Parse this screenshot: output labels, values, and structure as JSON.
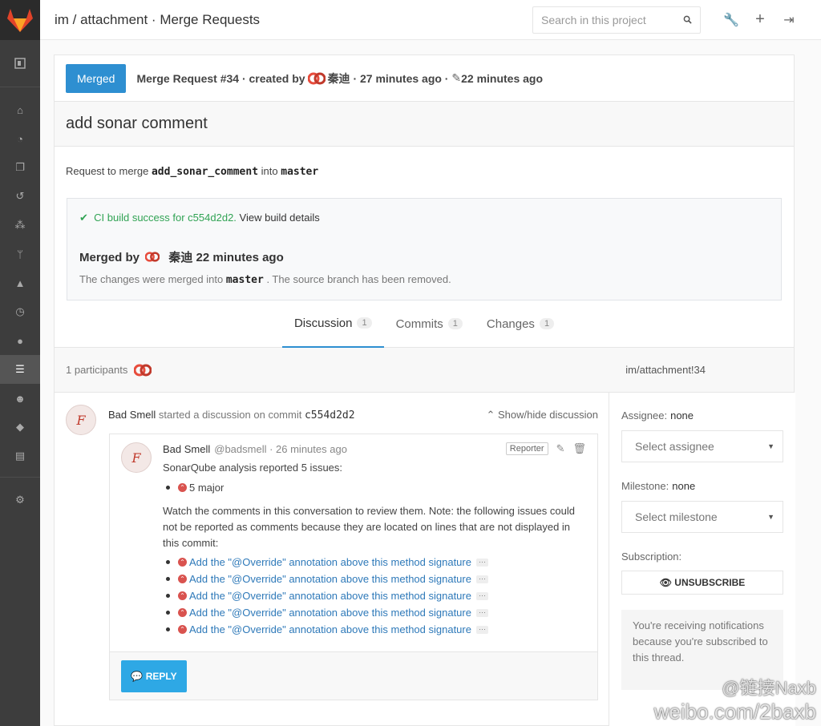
{
  "header": {
    "title": "im / attachment · Merge Requests",
    "search_placeholder": "Search in this project"
  },
  "sidebar": {
    "icons": [
      "collapse-icon",
      "home-icon",
      "dashboard-icon",
      "files-icon",
      "history-icon",
      "network-icon",
      "branch-icon",
      "graph-icon",
      "milestone-icon",
      "issues-icon",
      "merge-requests-icon",
      "members-icon",
      "labels-icon",
      "wiki-icon",
      "settings-icon"
    ]
  },
  "mr": {
    "status": "Merged",
    "meta_prefix": "Merge Request #34 · created by",
    "author": "秦迪",
    "created": "· 27 minutes ago ·",
    "edited": "22 minutes ago",
    "title": "add sonar comment",
    "request_prefix": "Request to merge",
    "source_branch": "add_sonar_comment",
    "into": "into",
    "target_branch": "master"
  },
  "ci": {
    "status_text": "CI build success for c554d2d2.",
    "details_link": "View build details",
    "merged_by_label": "Merged by",
    "merged_by_name": "秦迪",
    "merged_time": "22 minutes ago",
    "desc_prefix": "The changes were merged into",
    "desc_branch": "master",
    "desc_suffix": ". The source branch has been removed."
  },
  "tabs": [
    {
      "label": "Discussion",
      "count": "1"
    },
    {
      "label": "Commits",
      "count": "1"
    },
    {
      "label": "Changes",
      "count": "1"
    }
  ],
  "participants": {
    "label": "1 participants",
    "ref": "im/attachment!34"
  },
  "discussion": {
    "author": "Bad Smell",
    "action": "started a discussion on commit",
    "commit": "c554d2d2",
    "toggle": "Show/hide discussion",
    "note": {
      "author": "Bad Smell",
      "handle": "@badsmell · 26 minutes ago",
      "role": "Reporter",
      "line1": "SonarQube analysis reported 5 issues:",
      "major": "5 major",
      "line2": "Watch the comments in this conversation to review them. Note: the following issues could not be reported as comments because they are located on lines that are not displayed in this commit:",
      "issues": [
        "Add the \"@Override\" annotation above this method signature",
        "Add the \"@Override\" annotation above this method signature",
        "Add the \"@Override\" annotation above this method signature",
        "Add the \"@Override\" annotation above this method signature",
        "Add the \"@Override\" annotation above this method signature"
      ],
      "more": "···"
    },
    "reply_label": "REPLY"
  },
  "right": {
    "assignee_label": "Assignee:",
    "assignee_value": "none",
    "assignee_placeholder": "Select assignee",
    "milestone_label": "Milestone:",
    "milestone_value": "none",
    "milestone_placeholder": "Select milestone",
    "subscription_label": "Subscription:",
    "unsubscribe_label": "UNSUBSCRIBE",
    "notify_text": "You're receiving notifications because you're subscribed to this thread."
  },
  "watermark": {
    "line1": "@链接Naxb",
    "line2": "weibo.com/2baxb"
  },
  "colors": {
    "accent": "#2e8fd1",
    "success": "#31a354",
    "sidebar_bg": "#3d3d3d",
    "link": "#2e79b9",
    "danger": "#d9534f"
  }
}
